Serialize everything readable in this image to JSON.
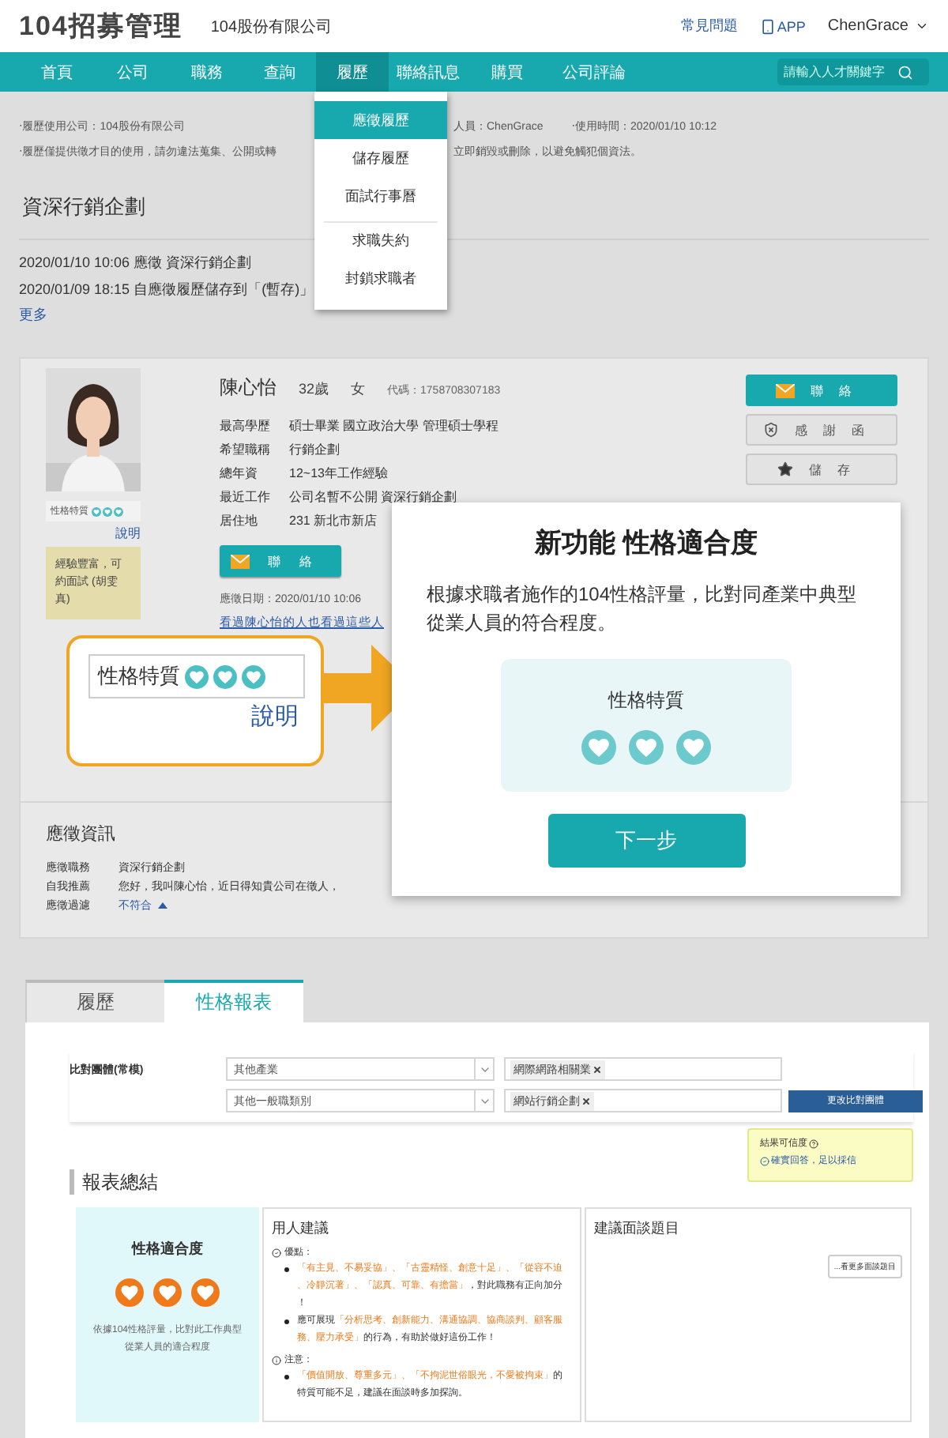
{
  "header": {
    "logo": "104招募管理",
    "company": "104股份有限公司",
    "links": [
      "常見問題",
      "APP"
    ],
    "user": "ChenGrace"
  },
  "nav": {
    "items": [
      {
        "label": "首頁",
        "selected": false
      },
      {
        "label": "公司",
        "selected": false
      },
      {
        "label": "職務",
        "selected": false
      },
      {
        "label": "查詢",
        "selected": false
      },
      {
        "label": "履歷",
        "selected": true
      },
      {
        "label": "聯絡訊息",
        "selected": false
      },
      {
        "label": "購買",
        "selected": false
      },
      {
        "label": "公司評論",
        "selected": false
      }
    ],
    "search": {
      "placeholder": "請輸入人才關鍵字"
    }
  },
  "dropdown": {
    "items": [
      {
        "label": "應徵履歷",
        "selected": true,
        "divider_before": false
      },
      {
        "label": "儲存履歷",
        "selected": false,
        "divider_before": false
      },
      {
        "label": "面試行事曆",
        "selected": false,
        "divider_before": false
      },
      {
        "label": "求職失約",
        "selected": false,
        "divider_before": true
      },
      {
        "label": "封鎖求職者",
        "selected": false,
        "divider_before": false
      }
    ]
  },
  "notice": {
    "line_1": [
      "‧履歷使用公司：104股份有限公司",
      "人員：ChenGrace",
      "‧使用時間：2020/01/10 10:12"
    ],
    "line_2": [
      "‧履歷僅提供徵才目的使用，請勿違法蒐集、公開或轉",
      "立即銷毀或刪除，以避免觸犯個資法。"
    ]
  },
  "job_title": "資深行銷企劃",
  "history": [
    "2020/01/10 10:06 應徵 資深行銷企劃",
    "2020/01/09 18:15 自應徵履歷儲存到「(暫存)」"
  ],
  "more_link": "更多",
  "resume": {
    "trait_label": "性格特質",
    "hearts": [
      {
        "filled": true
      },
      {
        "filled": true
      },
      {
        "filled": true
      }
    ],
    "explain_link": "說明",
    "note": "經驗豐富，可約面試 (胡雯真)",
    "name": "陳心怡",
    "age": "32歲",
    "gender": "女",
    "code": "代碼：1758708307183",
    "fields": [
      {
        "label": "最高學歷",
        "value": "碩士畢業 國立政治大學 管理碩士學程"
      },
      {
        "label": "希望職稱",
        "value": "行銷企劃"
      },
      {
        "label": "總年資",
        "value": "12~13年工作經驗"
      },
      {
        "label": "最近工作",
        "value": "公司名暫不公開 資深行銷企劃"
      },
      {
        "label": "居住地",
        "value": "231 新北市新店"
      }
    ],
    "contact_button": "聯絡",
    "apply_date": "應徵日期：2020/01/10 10:06",
    "related_link": "看過陳心怡的人也看過這些人",
    "actions": [
      {
        "label": "聯絡",
        "kind": "contact"
      },
      {
        "label": "感謝函",
        "kind": "thanks"
      },
      {
        "label": "儲存",
        "kind": "save"
      }
    ]
  },
  "application": {
    "title": "應徵資訊",
    "rows": [
      {
        "label": "應徵職務",
        "value": "資深行銷企劃",
        "kind": "text"
      },
      {
        "label": "自我推薦",
        "value": "您好，我叫陳心怡，近日得知貴公司在徵人，",
        "kind": "text"
      },
      {
        "label": "應徵過濾",
        "value": "不符合",
        "kind": "filter"
      }
    ]
  },
  "callout": {
    "trait_label": "性格特質",
    "hearts": [
      {
        "filled": true
      },
      {
        "filled": true
      },
      {
        "filled": true
      }
    ],
    "explain_link": "說明"
  },
  "modal": {
    "title": "新功能 性格適合度",
    "body": "根據求職者施作的104性格評量，比對同產業中典型從業人員的符合程度。",
    "card_label": "性格特質",
    "hearts": [
      {
        "filled": true
      },
      {
        "filled": true
      },
      {
        "filled": true
      }
    ],
    "button": "下一步"
  },
  "report": {
    "tabs": [
      {
        "label": "履歷",
        "selected": false
      },
      {
        "label": "性格報表",
        "selected": true
      }
    ],
    "filter": {
      "label": "比對團體(常模)",
      "rows": [
        {
          "select": "其他產業",
          "chip": "網際網路相關業"
        },
        {
          "select": "其他一般職類別",
          "chip": "網站行銷企劃"
        }
      ],
      "button": "更改比對團體"
    },
    "reliability": {
      "title": "結果可信度",
      "status": "確實回答，足以採信"
    },
    "summary_title": "報表總結",
    "fit": {
      "title": "性格適合度",
      "hearts": [
        {
          "filled": true
        },
        {
          "filled": true
        },
        {
          "filled": true
        }
      ],
      "caption": "依據104性格評量，比對此工作典型從業人員的適合程度"
    },
    "advice": {
      "title": "用人建議",
      "groups": [
        {
          "kind": "strength",
          "label": "優點：",
          "bullets": [
            [
              {
                "text": "「有主見、不易妥協」、「古靈精怪、創意十足」、「從容不迫、冷靜沉著」、「認真、可靠、有擔當」",
                "highlight": true
              },
              {
                "text": "，對此職務有正向加分！",
                "highlight": false
              }
            ],
            [
              {
                "text": "應可展現",
                "highlight": false
              },
              {
                "text": "「分析思考、創新能力、溝通協調、協商談判、顧客服務、壓力承受」",
                "highlight": true
              },
              {
                "text": "的行為，有助於做好這份工作！",
                "highlight": false
              }
            ]
          ]
        },
        {
          "kind": "caution",
          "label": "注意：",
          "bullets": [
            [
              {
                "text": "「價值開放、尊重多元」、「不拘泥世俗眼光，不愛被拘束」",
                "highlight": true
              },
              {
                "text": "的特質可能不足，建議在面談時多加探詢。",
                "highlight": false
              }
            ]
          ]
        }
      ]
    },
    "questions": {
      "title": "建議面談題目",
      "button": "...看更多面談題目"
    }
  }
}
